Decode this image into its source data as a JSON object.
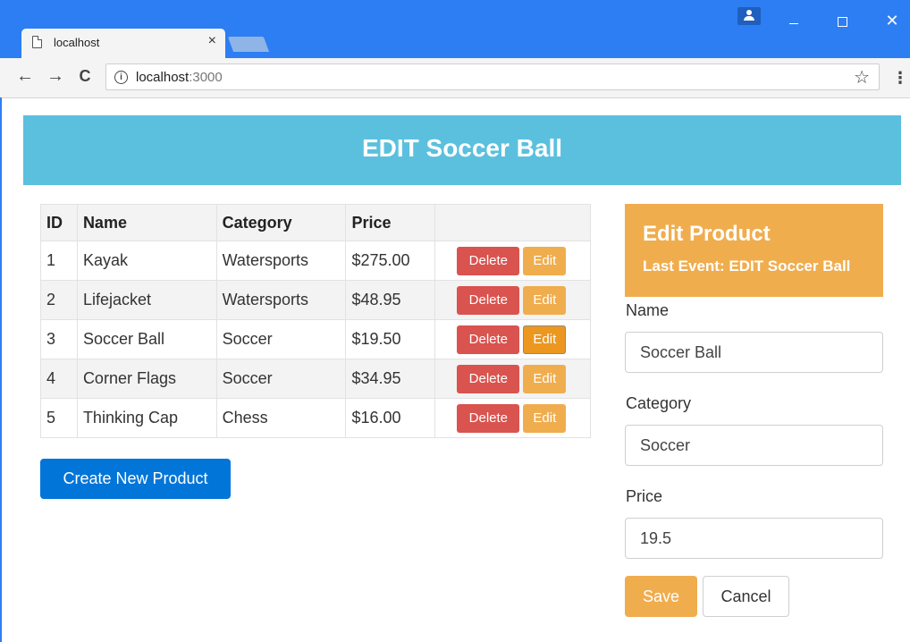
{
  "browser": {
    "tab_title": "localhost",
    "tab_close": "×",
    "url_host": "localhost",
    "url_port": ":3000",
    "back": "←",
    "forward": "→",
    "reload": "C",
    "star": "☆",
    "menu": "⋮",
    "close_window": "✕"
  },
  "banner": {
    "title": "EDIT Soccer Ball",
    "color": "#5bc0de"
  },
  "table": {
    "headers": [
      "ID",
      "Name",
      "Category",
      "Price",
      ""
    ],
    "rows": [
      {
        "id": "1",
        "name": "Kayak",
        "category": "Watersports",
        "price": "$275.00",
        "delete_label": "Delete",
        "edit_label": "Edit"
      },
      {
        "id": "2",
        "name": "Lifejacket",
        "category": "Watersports",
        "price": "$48.95",
        "delete_label": "Delete",
        "edit_label": "Edit"
      },
      {
        "id": "3",
        "name": "Soccer Ball",
        "category": "Soccer",
        "price": "$19.50",
        "delete_label": "Delete",
        "edit_label": "Edit"
      },
      {
        "id": "4",
        "name": "Corner Flags",
        "category": "Soccer",
        "price": "$34.95",
        "delete_label": "Delete",
        "edit_label": "Edit"
      },
      {
        "id": "5",
        "name": "Thinking Cap",
        "category": "Chess",
        "price": "$16.00",
        "delete_label": "Delete",
        "edit_label": "Edit"
      }
    ]
  },
  "create_button": "Create New Product",
  "editor": {
    "title": "Edit Product",
    "last_event": "Last Event: EDIT Soccer Ball",
    "name_label": "Name",
    "name_value": "Soccer Ball",
    "category_label": "Category",
    "category_value": "Soccer",
    "price_label": "Price",
    "price_value": "19.5",
    "save_label": "Save",
    "cancel_label": "Cancel"
  },
  "colors": {
    "delete": "#d9534f",
    "edit": "#f0ad4e",
    "primary": "#0275d8",
    "chrome": "#2d7ef2"
  }
}
